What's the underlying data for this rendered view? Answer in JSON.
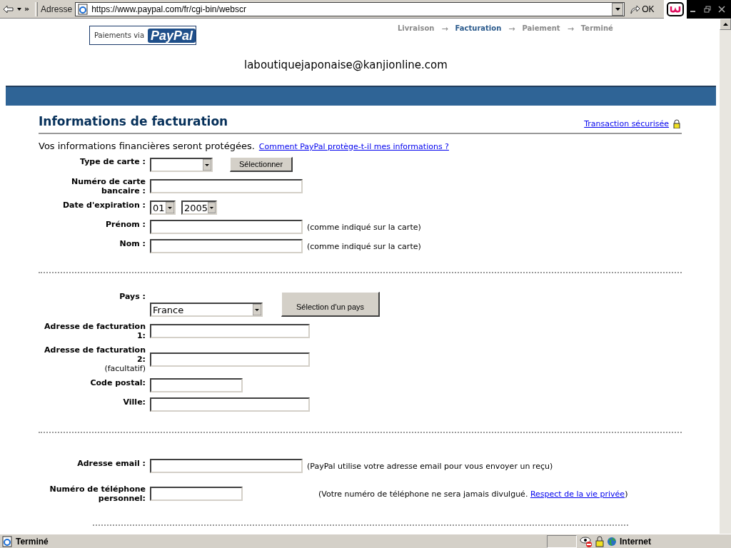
{
  "browser": {
    "chevron": "»",
    "address_label": "Adresse",
    "url": "https://www.paypal.com/fr/cgi-bin/webscr",
    "go": "OK"
  },
  "header": {
    "logo_text": "Paiements via",
    "logo_brand": "PayPal",
    "steps": [
      {
        "label": "Livraison",
        "selected": false
      },
      {
        "label": "Facturation",
        "selected": true
      },
      {
        "label": "Paiement",
        "selected": false
      },
      {
        "label": "Terminé",
        "selected": false
      }
    ],
    "step_arrow": "→",
    "email": "laboutiquejaponaise@kanjionline.com"
  },
  "title": "Informations de facturation",
  "secure_link": "Transaction sécurisée",
  "intro": "Vos informations financières seront protégées.",
  "intro_link": "Comment PayPal protège-t-il mes informations ?",
  "sections": [
    {
      "fields": [
        {
          "kind": "select",
          "label": "Type de carte :",
          "button": "Sélectionner"
        },
        {
          "kind": "text",
          "label": "Numéro de carte bancaire :"
        },
        {
          "kind": "expiry",
          "label": "Date d'expiration :",
          "month": "01",
          "year": "2005"
        },
        {
          "kind": "text",
          "label": "Prénom :",
          "hint": "(comme indiqué sur la carte)"
        },
        {
          "kind": "text",
          "label": "Nom :",
          "hint": "(comme indiqué sur la carte)"
        }
      ]
    },
    {
      "fields": [
        {
          "kind": "country",
          "label": "Pays :",
          "value": "France",
          "button": "Sélection d'un pays"
        },
        {
          "kind": "wide",
          "label": "Adresse de facturation 1:"
        },
        {
          "kind": "wide",
          "label": "Adresse de facturation 2:",
          "note": "(facultatif)"
        },
        {
          "kind": "short",
          "label": "Code postal:"
        },
        {
          "kind": "wide",
          "label": "Ville:"
        }
      ]
    },
    {
      "fields": [
        {
          "kind": "text",
          "label": "Adresse email :",
          "hint": "(PayPal utilise votre adresse email pour vous envoyer un reçu)"
        },
        {
          "kind": "short",
          "label": "Numéro de téléphone personnel:",
          "hint_before": "(Votre numéro de téléphone ne sera jamais divulgué. ",
          "hint_link": "Respect de la vie privée",
          "hint_after": ")"
        }
      ]
    }
  ],
  "status_bar": {
    "text": "Terminé",
    "zone": "Internet"
  }
}
